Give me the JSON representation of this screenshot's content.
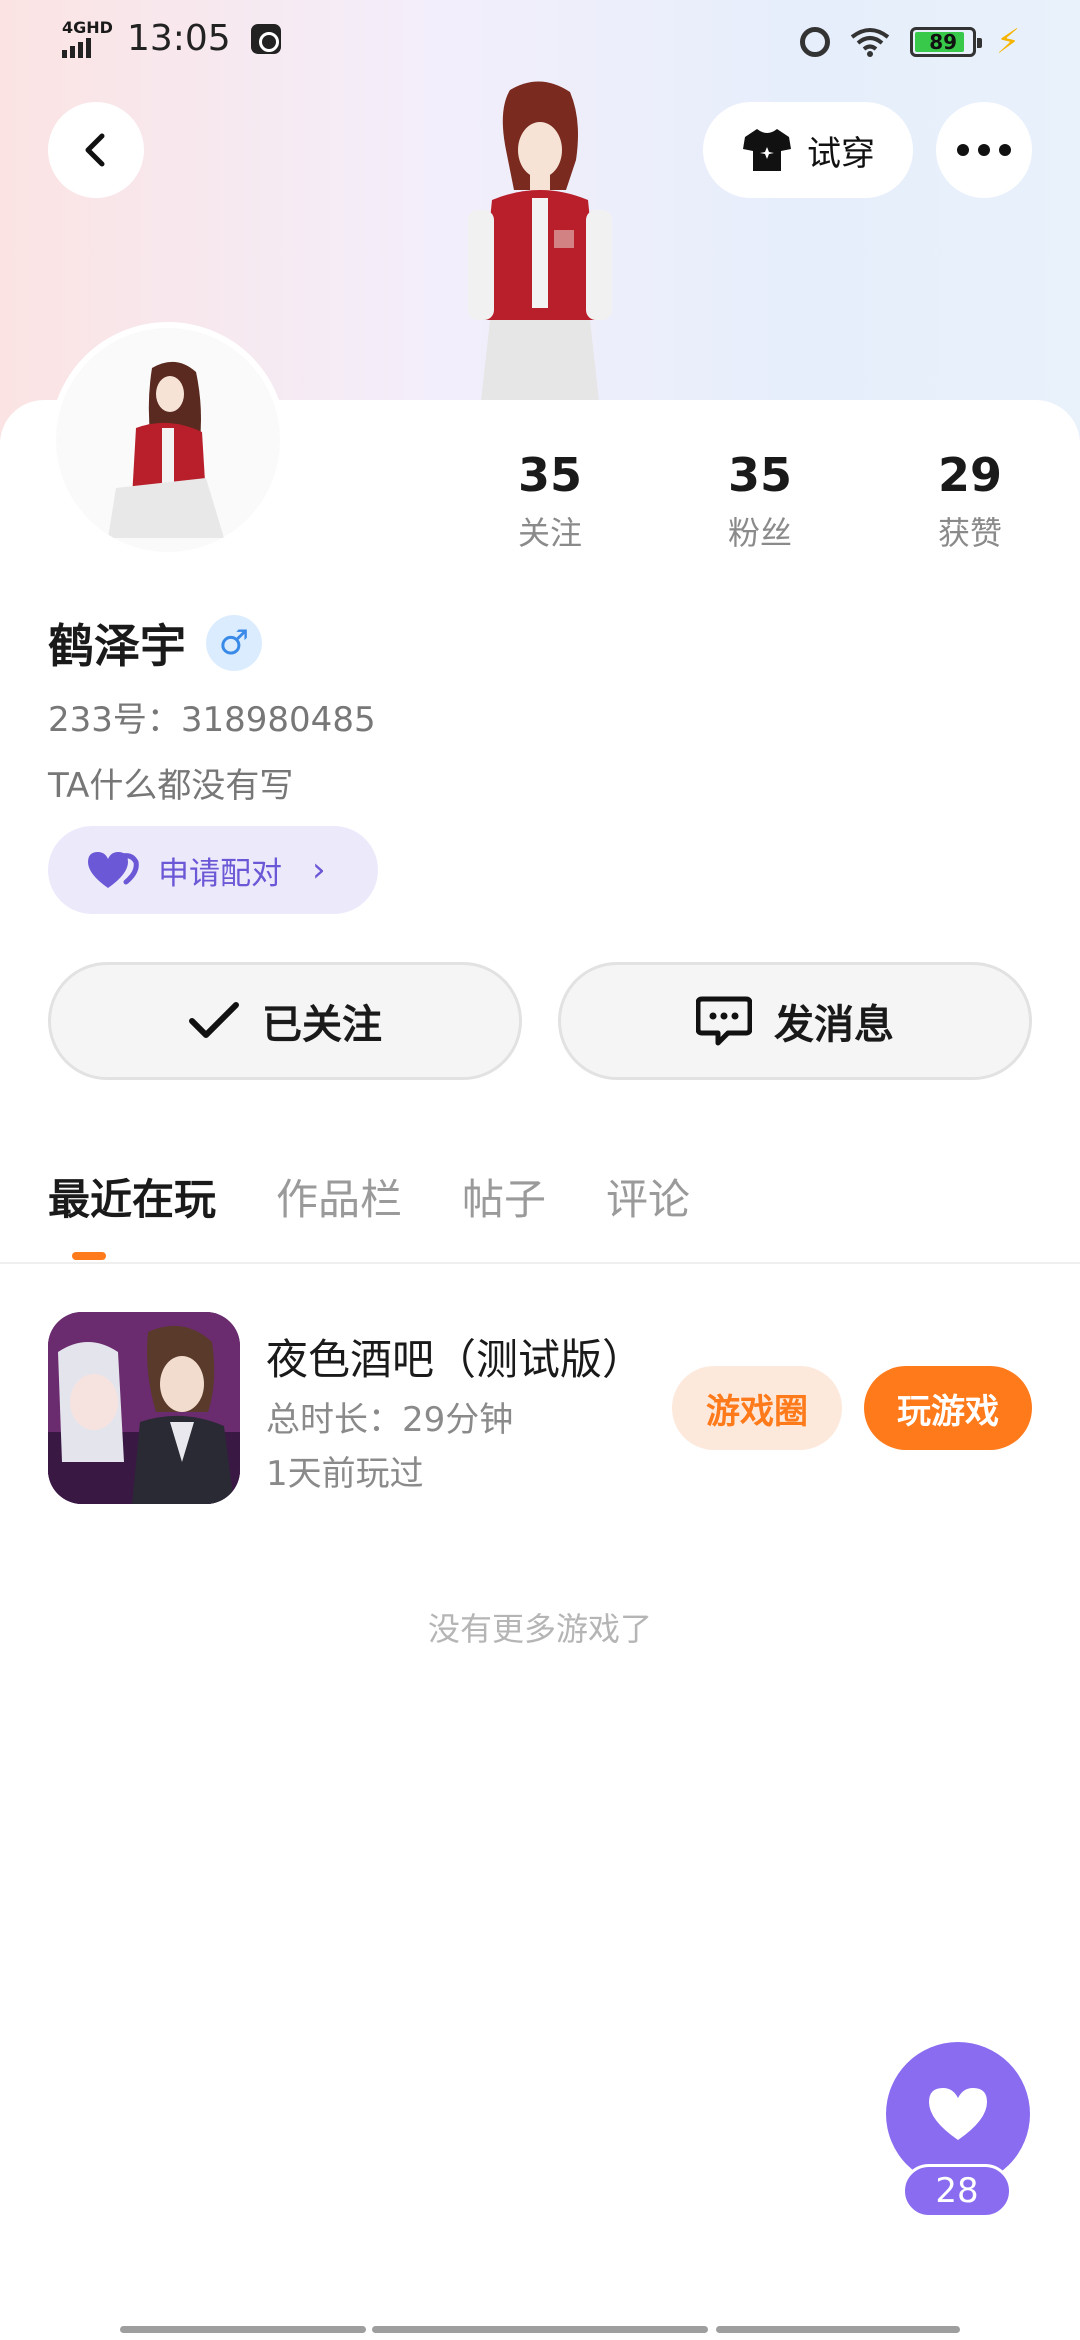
{
  "status_bar": {
    "network": "4GHD",
    "time": "13:05",
    "battery": "89"
  },
  "header": {
    "try_on_label": "试穿"
  },
  "profile": {
    "stats": [
      {
        "value": "35",
        "label": "关注"
      },
      {
        "value": "35",
        "label": "粉丝"
      },
      {
        "value": "29",
        "label": "获赞"
      }
    ],
    "name": "鹤泽宇",
    "gender_symbol": "♂",
    "uid": "233号：318980485",
    "bio": "TA什么都没有写",
    "pair_label": "申请配对",
    "follow_label": "已关注",
    "message_label": "发消息"
  },
  "tabs": [
    {
      "label": "最近在玩",
      "active": true
    },
    {
      "label": "作品栏",
      "active": false
    },
    {
      "label": "帖子",
      "active": false
    },
    {
      "label": "评论",
      "active": false
    }
  ],
  "games": [
    {
      "title": "夜色酒吧（测试版）",
      "duration": "总时长：29分钟",
      "last_played": "1天前玩过",
      "circle_label": "游戏圈",
      "play_label": "玩游戏"
    }
  ],
  "empty_hint": "没有更多游戏了",
  "like_fab": {
    "count": "28"
  },
  "colors": {
    "accent_orange": "#ff7a1a",
    "accent_purple": "#8a6cf0",
    "pair_purple": "#6a58d6"
  }
}
